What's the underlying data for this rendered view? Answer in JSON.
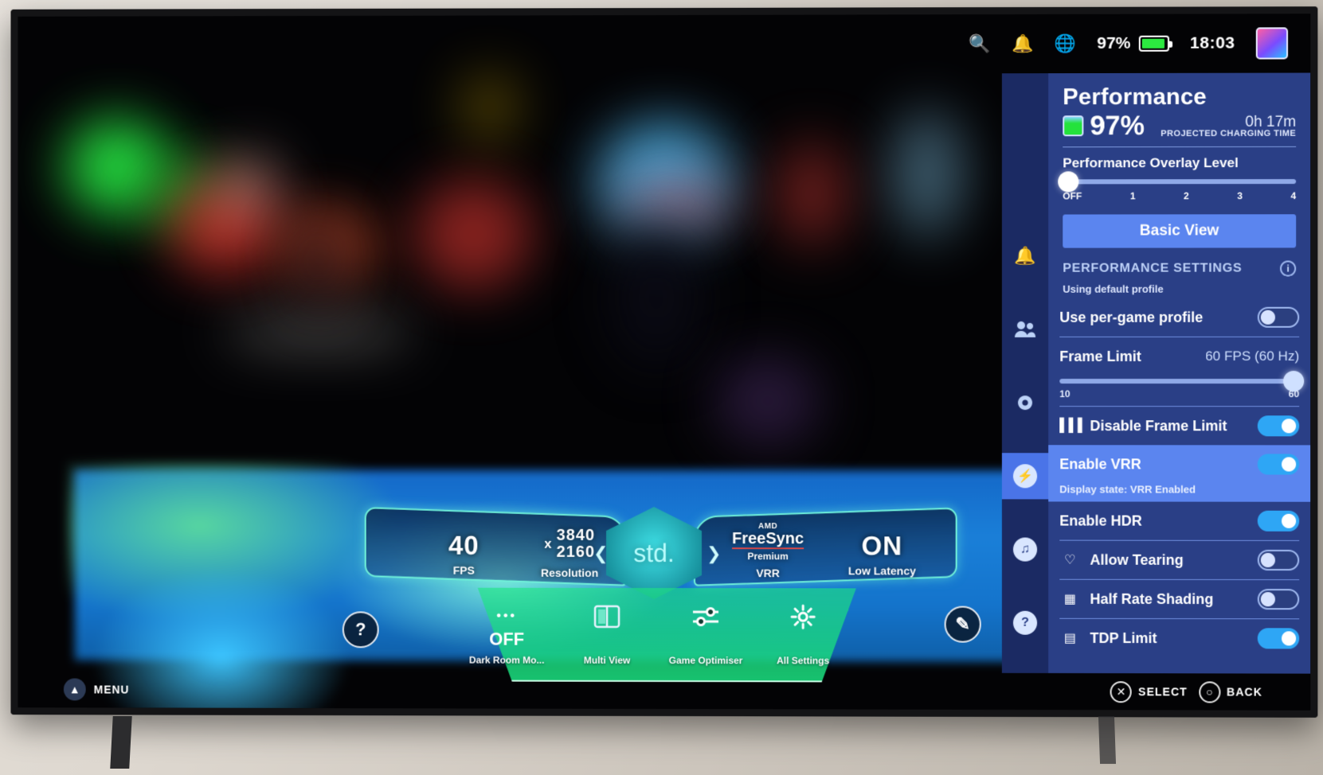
{
  "topbar": {
    "icons": [
      "search-icon",
      "bell-icon",
      "globe-icon"
    ],
    "battery_percent": "97%",
    "clock": "18:03",
    "avatar": "user-avatar"
  },
  "panel": {
    "title": "Performance",
    "battery_value": "97%",
    "charging_time": "0h 17m",
    "charging_label": "PROJECTED CHARGING TIME",
    "overlay_level_title": "Performance Overlay Level",
    "overlay_ticks": [
      "OFF",
      "1",
      "2",
      "3",
      "4"
    ],
    "overlay_selected_index": 0,
    "basic_view_label": "Basic View",
    "settings_header": "PERFORMANCE SETTINGS",
    "profile_note": "Using default profile",
    "rows": [
      {
        "name": "use-per-game-profile",
        "label": "Use per-game profile",
        "toggle": "off",
        "icon": null,
        "selected": false
      },
      {
        "name": "frame-limit",
        "label": "Frame Limit",
        "value": "60 FPS (60 Hz)",
        "slider_min": "10",
        "slider_max": "60",
        "selected": false
      },
      {
        "name": "disable-frame-limit",
        "label": "Disable Frame Limit",
        "icon": "bars-icon",
        "toggle": "on",
        "selected": false
      },
      {
        "name": "enable-vrr",
        "label": "Enable VRR",
        "toggle": "on",
        "substate": "Display state: VRR Enabled",
        "selected": true
      },
      {
        "name": "enable-hdr",
        "label": "Enable HDR",
        "toggle": "on",
        "selected": false
      },
      {
        "name": "allow-tearing",
        "label": "Allow Tearing",
        "icon": "heart-icon",
        "toggle": "off",
        "selected": false
      },
      {
        "name": "half-rate-shading",
        "label": "Half Rate Shading",
        "icon": "grid-dots-icon",
        "toggle": "off",
        "selected": false
      },
      {
        "name": "tdp-limit",
        "label": "TDP Limit",
        "icon": "chip-icon",
        "toggle": "on",
        "selected": false
      }
    ],
    "rail": [
      {
        "name": "notifications",
        "glyph": "ὑ4",
        "active": false
      },
      {
        "name": "friends",
        "glyph": "friends",
        "active": false
      },
      {
        "name": "settings",
        "glyph": "gear",
        "active": false
      },
      {
        "name": "performance",
        "glyph": "bolt",
        "active": true
      },
      {
        "name": "sound",
        "glyph": "music",
        "active": false
      },
      {
        "name": "help",
        "glyph": "?",
        "active": false
      }
    ]
  },
  "gamebar": {
    "fps_value": "40",
    "fps_label": "FPS",
    "res_x": "x",
    "res_value_1": "3840",
    "res_value_2": "2160",
    "res_label": "Resolution",
    "freesync_amd": "AMD",
    "freesync_name": "FreeSync",
    "freesync_tier": "Premium",
    "vrr_label": "VRR",
    "latency_value": "ON",
    "latency_label": "Low Latency",
    "center_badge": "std.",
    "tray": [
      {
        "name": "dark-room-mode",
        "icon": "•••",
        "value": "OFF",
        "label": "Dark Room Mo..."
      },
      {
        "name": "multi-view",
        "icon": "split-panel-icon",
        "value": "",
        "label": "Multi View"
      },
      {
        "name": "game-optimiser",
        "icon": "sliders-icon",
        "value": "",
        "label": "Game Optimiser"
      },
      {
        "name": "all-settings",
        "icon": "gear-icon",
        "value": "",
        "label": "All Settings"
      }
    ],
    "help_glyph": "?",
    "edit_glyph": "✎"
  },
  "bottombar": {
    "menu_label": "MENU",
    "select_label": "SELECT",
    "back_label": "BACK",
    "select_glyph": "✕",
    "back_glyph": "○"
  },
  "colors": {
    "panel_bg": "#2a3f86",
    "panel_rail": "#1b2a63",
    "accent": "#5b85ef",
    "toggle_on": "#2ea6f5",
    "battery_green": "#2ce840",
    "hud_cyan": "#6ff0d8"
  }
}
